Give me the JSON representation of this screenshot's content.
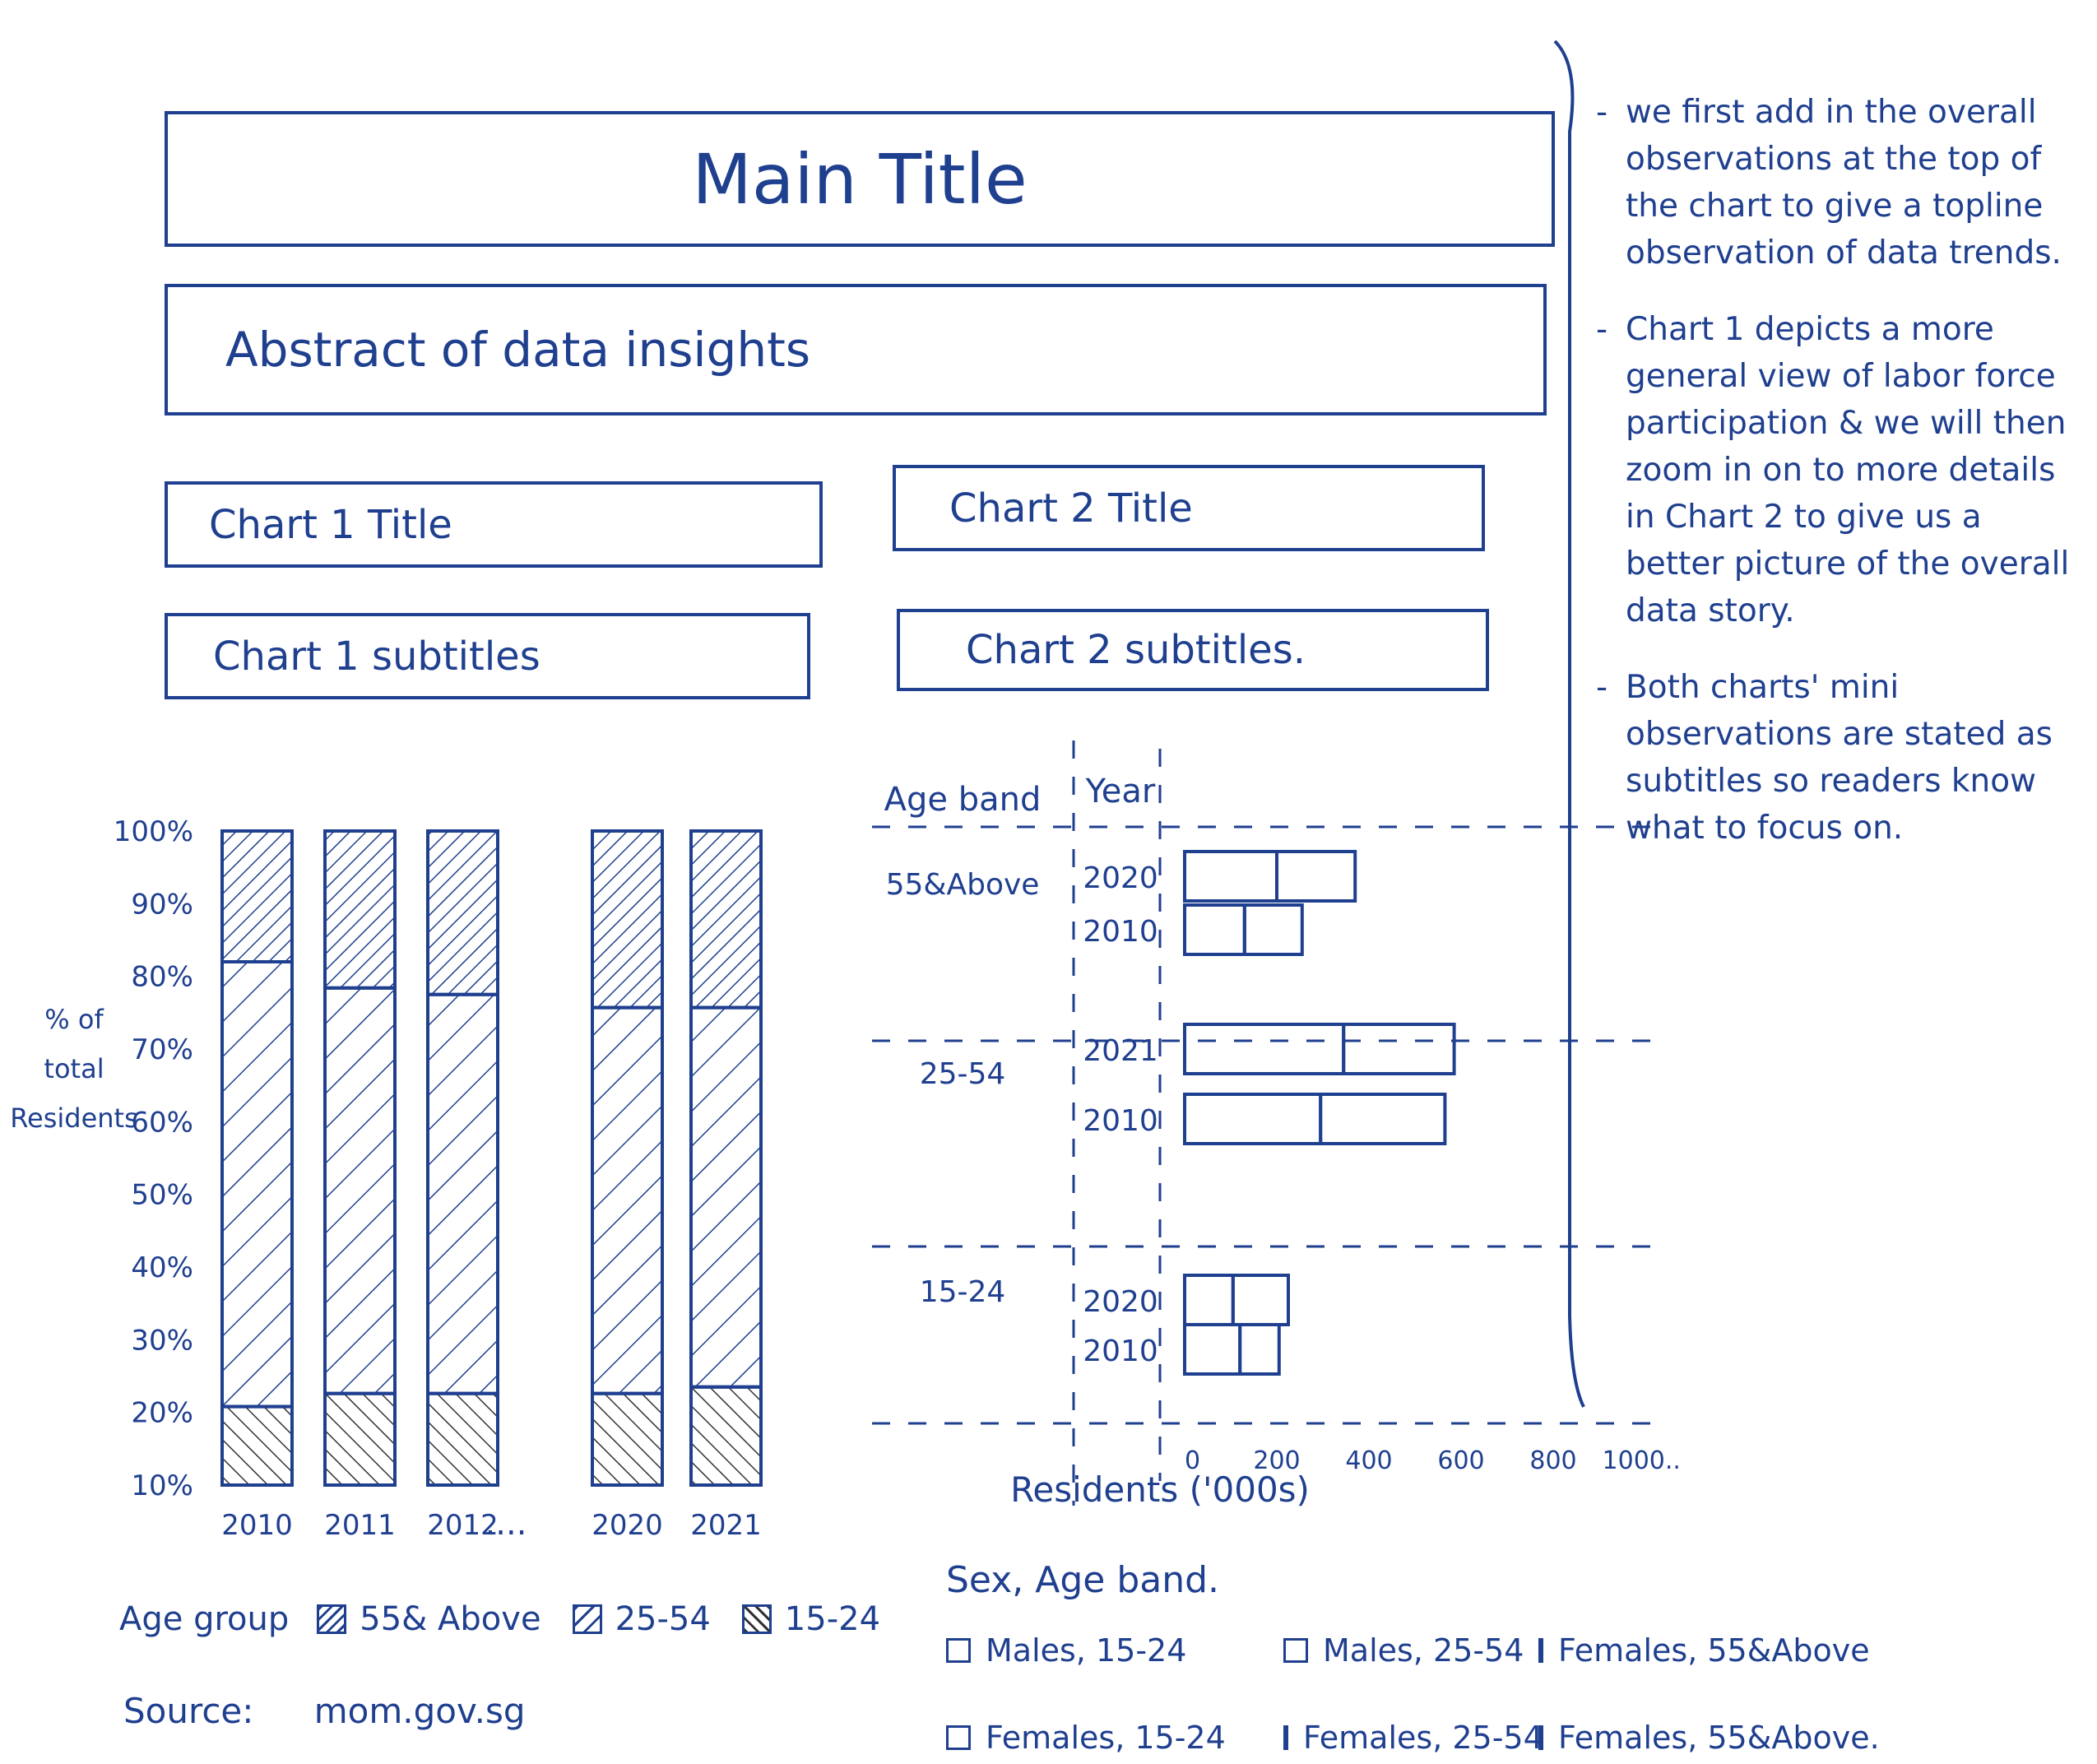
{
  "header": {
    "main_title": "Main Title",
    "abstract": "Abstract of data insights"
  },
  "chart1": {
    "title_box": "Chart 1 Title",
    "subtitle_box": "Chart 1 subtitles"
  },
  "chart2": {
    "title_box": "Chart 2 Title",
    "subtitle_box": "Chart 2 subtitles."
  },
  "chart_data": [
    {
      "type": "bar",
      "stacked": true,
      "ylabel": "% of total Residents",
      "ytick_labels": [
        "100%",
        "90%",
        "80%",
        "70%",
        "60%",
        "50%",
        "40%",
        "30%",
        "20%",
        "10%"
      ],
      "ylim": [
        10,
        100
      ],
      "categories": [
        "2010",
        "2011",
        "2012",
        "2020",
        "2021"
      ],
      "ellipsis_label": "....",
      "series": [
        {
          "name": "15-24",
          "pattern": "hatch",
          "values": [
            12,
            14,
            14,
            14,
            15
          ]
        },
        {
          "name": "25-54",
          "pattern": "sparse",
          "values": [
            68,
            62,
            61,
            59,
            58
          ]
        },
        {
          "name": "55& Above",
          "pattern": "dense",
          "values": [
            20,
            24,
            25,
            27,
            27
          ]
        }
      ],
      "legend": {
        "title": "Age group",
        "items": [
          {
            "label": "55& Above",
            "pattern": "dense"
          },
          {
            "label": "25-54",
            "pattern": "sparse"
          },
          {
            "label": "15-24",
            "pattern": "hatch"
          }
        ]
      },
      "source_label": "Source:",
      "source_value": "mom.gov.sg",
      "grid": false
    },
    {
      "type": "bar",
      "orientation": "horizontal",
      "stacked": true,
      "col_headers": [
        "Age band",
        "Year"
      ],
      "xlabel": "Residents ('000s)",
      "xtick_labels": [
        "0",
        "200",
        "400",
        "600",
        "800",
        "1000..."
      ],
      "xlim": [
        0,
        1000
      ],
      "groups": [
        {
          "label": "55&Above",
          "rows": [
            {
              "year": "2020",
              "segments": [
                200,
                170
              ]
            },
            {
              "year": "2010",
              "segments": [
                130,
                125
              ]
            }
          ]
        },
        {
          "label": "25-54",
          "rows": [
            {
              "year": "2021",
              "segments": [
                345,
                240
              ]
            },
            {
              "year": "2010",
              "segments": [
                295,
                270
              ]
            }
          ]
        },
        {
          "label": "15-24",
          "rows": [
            {
              "year": "2020",
              "segments": [
                105,
                120
              ]
            },
            {
              "year": "2010",
              "segments": [
                120,
                85
              ]
            }
          ]
        }
      ],
      "legend": {
        "title": "Sex, Age band.",
        "items": [
          "Males, 15-24",
          "Males, 25-54",
          "Females, 55&Above",
          "Females, 15-24",
          "Females, 25-54",
          "Females, 55&Above."
        ]
      }
    }
  ],
  "notes": [
    "we first add in the overall observations at the top of the chart to give a topline observation of data trends.",
    "Chart 1 depicts a more general view of labor force participation & we will then zoom in on to more details in Chart 2 to give us a better picture of the overall data story.",
    "Both charts' mini observations are stated as subtitles so readers know what to focus on."
  ],
  "note_bullet": "-",
  "colors": {
    "ink": "#1f3f8f",
    "hatch": "#333333",
    "background": "#ffffff"
  }
}
